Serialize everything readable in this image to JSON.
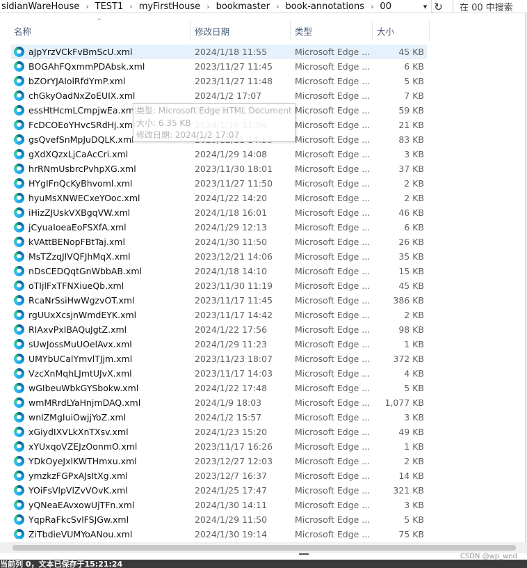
{
  "address": {
    "crumbs": [
      "sidianWareHouse",
      "TEST1",
      "myFirstHouse",
      "bookmaster",
      "book-annotations",
      "00"
    ],
    "separator": "›",
    "dropdown_icon": "chevron-down-icon",
    "refresh_icon": "refresh-icon"
  },
  "search": {
    "placeholder": "在 00 中搜索"
  },
  "columns": {
    "name": "名称",
    "date": "修改日期",
    "type": "类型",
    "size": "大小"
  },
  "files": [
    {
      "name": "aJpYrzVCkFvBmScU.xml",
      "date": "2024/1/18 11:55",
      "type": "Microsoft Edge ...",
      "size": "45 KB",
      "selected": true
    },
    {
      "name": "BOGAhFQxmmPDAbsk.xml",
      "date": "2023/11/27 11:45",
      "type": "Microsoft Edge ...",
      "size": "6 KB"
    },
    {
      "name": "bZOrYJAIolRfdYmP.xml",
      "date": "2023/11/27 11:48",
      "type": "Microsoft Edge ...",
      "size": "5 KB"
    },
    {
      "name": "chGkyOadNxZoEUIX.xml",
      "date": "2024/1/2 17:07",
      "type": "Microsoft Edge ...",
      "size": "7 KB"
    },
    {
      "name": "essHtHcmLCmpjwEa.xml",
      "date": "2024/1/31 15:03",
      "type": "Microsoft Edge ...",
      "size": "59 KB"
    },
    {
      "name": "FcDCOEoYHvcSRdHj.xml",
      "date": "2024/1/19 11:04",
      "type": "Microsoft Edge ...",
      "size": "21 KB"
    },
    {
      "name": "gsQvefSnMpJuDQLK.xml",
      "date": "2023/12/21 14:58",
      "type": "Microsoft Edge ...",
      "size": "83 KB"
    },
    {
      "name": "gXdXQzxLjCaAcCri.xml",
      "date": "2024/1/29 14:08",
      "type": "Microsoft Edge ...",
      "size": "3 KB"
    },
    {
      "name": "hrRNmUsbrcPvhpXG.xml",
      "date": "2023/11/30 18:01",
      "type": "Microsoft Edge ...",
      "size": "37 KB"
    },
    {
      "name": "HYgIFnQcKyBhvoml.xml",
      "date": "2023/11/27 11:50",
      "type": "Microsoft Edge ...",
      "size": "2 KB"
    },
    {
      "name": "hyuMsXNWECxeYOoc.xml",
      "date": "2024/1/22 14:20",
      "type": "Microsoft Edge ...",
      "size": "2 KB"
    },
    {
      "name": "iHizZJUskVXBgqVW.xml",
      "date": "2024/1/18 16:01",
      "type": "Microsoft Edge ...",
      "size": "46 KB"
    },
    {
      "name": "jCyuaIoeaEoFSXfA.xml",
      "date": "2024/1/29 12:13",
      "type": "Microsoft Edge ...",
      "size": "6 KB"
    },
    {
      "name": "kVAttBENopFBtTaj.xml",
      "date": "2024/1/30 11:50",
      "type": "Microsoft Edge ...",
      "size": "26 KB"
    },
    {
      "name": "MsTZzqJlVQFJhMqX.xml",
      "date": "2023/12/21 14:06",
      "type": "Microsoft Edge ...",
      "size": "35 KB"
    },
    {
      "name": "nDsCEDQqtGnWbbAB.xml",
      "date": "2024/1/18 14:10",
      "type": "Microsoft Edge ...",
      "size": "15 KB"
    },
    {
      "name": "oTIjlFxTFNXiueQb.xml",
      "date": "2023/11/30 11:19",
      "type": "Microsoft Edge ...",
      "size": "45 KB"
    },
    {
      "name": "RcaNrSsiHwWgzvOT.xml",
      "date": "2023/11/17 11:45",
      "type": "Microsoft Edge ...",
      "size": "386 KB"
    },
    {
      "name": "rgUUxXcsjnWmdEYK.xml",
      "date": "2023/11/17 14:42",
      "type": "Microsoft Edge ...",
      "size": "2 KB"
    },
    {
      "name": "RIAxvPxIBAQuJgtZ.xml",
      "date": "2024/1/22 17:56",
      "type": "Microsoft Edge ...",
      "size": "98 KB"
    },
    {
      "name": "sUwJossMuUOelAvx.xml",
      "date": "2024/1/29 11:23",
      "type": "Microsoft Edge ...",
      "size": "1 KB"
    },
    {
      "name": "UMYbUCalYmvlTJjm.xml",
      "date": "2023/11/23 18:07",
      "type": "Microsoft Edge ...",
      "size": "372 KB"
    },
    {
      "name": "VzcXnMqhLJmtUJvX.xml",
      "date": "2023/11/17 14:03",
      "type": "Microsoft Edge ...",
      "size": "4 KB"
    },
    {
      "name": "wGIbeuWbkGYSbokw.xml",
      "date": "2024/1/22 17:48",
      "type": "Microsoft Edge ...",
      "size": "5 KB"
    },
    {
      "name": "wmMRrdLYaHnjmDAQ.xml",
      "date": "2024/1/9 18:03",
      "type": "Microsoft Edge ...",
      "size": "1,077 KB"
    },
    {
      "name": "wnlZMgIuiOwjjYoZ.xml",
      "date": "2024/1/2 15:57",
      "type": "Microsoft Edge ...",
      "size": "3 KB"
    },
    {
      "name": "xGiydIXVLkXnTXsv.xml",
      "date": "2024/1/23 15:20",
      "type": "Microsoft Edge ...",
      "size": "49 KB"
    },
    {
      "name": "xYUxqoVZEJzOonmO.xml",
      "date": "2023/11/17 16:26",
      "type": "Microsoft Edge ...",
      "size": "1 KB"
    },
    {
      "name": "YDkOyeJxlKWTHmxu.xml",
      "date": "2023/12/27 12:03",
      "type": "Microsoft Edge ...",
      "size": "2 KB"
    },
    {
      "name": "ymzkzFGPxAJsItXg.xml",
      "date": "2023/12/7 16:37",
      "type": "Microsoft Edge ...",
      "size": "14 KB"
    },
    {
      "name": "YOiFsVlpVlZvVOvK.xml",
      "date": "2024/1/25 17:47",
      "type": "Microsoft Edge ...",
      "size": "321 KB"
    },
    {
      "name": "yQNeaEAvxowUjTFn.xml",
      "date": "2024/1/30 14:11",
      "type": "Microsoft Edge ...",
      "size": "3 KB"
    },
    {
      "name": "YqpRaFkcSvlFSJGw.xml",
      "date": "2024/1/29 11:50",
      "type": "Microsoft Edge ...",
      "size": "5 KB"
    },
    {
      "name": "ZiTbdieVUMYoANou.xml",
      "date": "2024/1/30 19:14",
      "type": "Microsoft Edge ...",
      "size": "75 KB"
    }
  ],
  "file_icon": "edge-icon",
  "tooltip": {
    "type_line": "类型: Microsoft Edge HTML Document",
    "size_line": "大小: 6.35 KB",
    "date_line": "修改日期: 2024/1/2 17:07"
  },
  "status": {
    "text": "当前列 0，文本已保存于15:21:24"
  },
  "watermark": "CSDN @wp_wnd"
}
